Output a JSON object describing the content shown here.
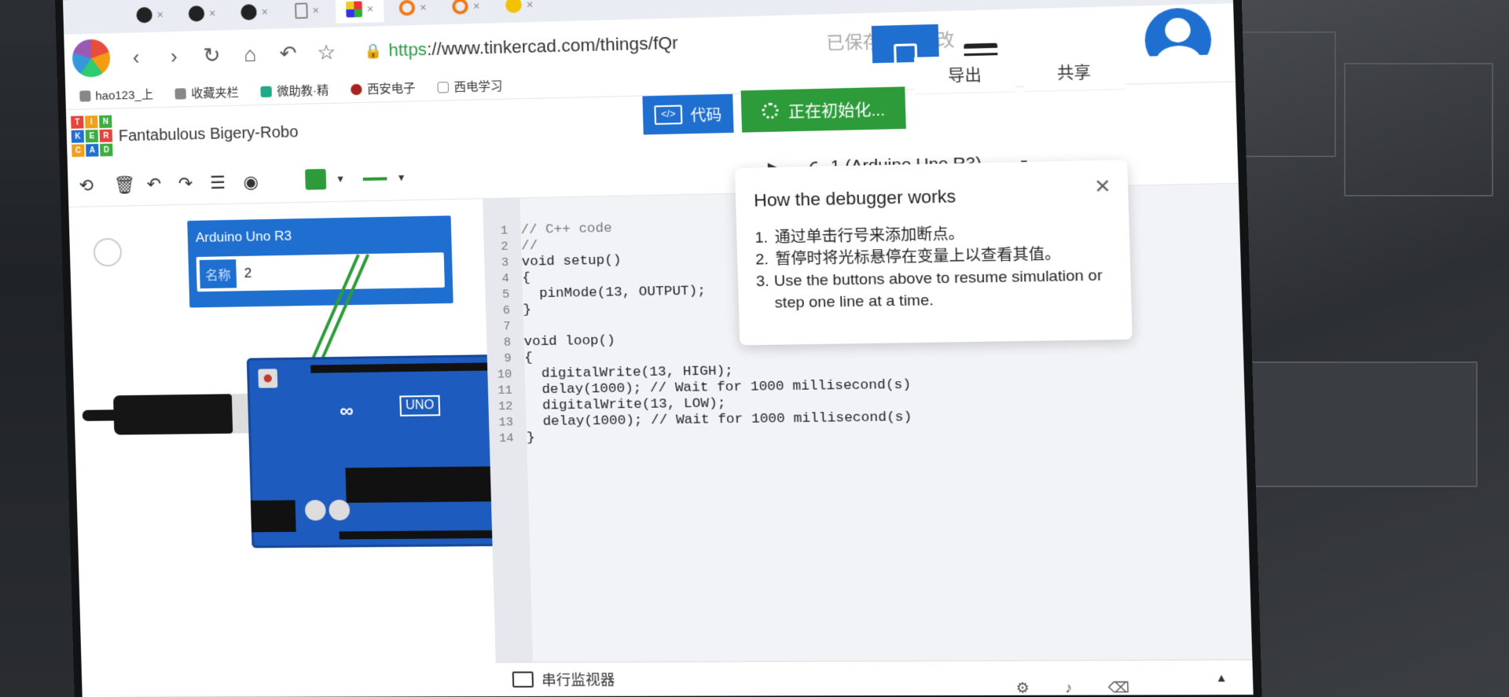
{
  "browser": {
    "url_scheme": "https",
    "url_rest": "://www.tinkercad.com/things/fQr",
    "saved_status": "已保存所有更改",
    "bookmarks": [
      "hao123_上",
      "收藏夹栏",
      "微助教·精",
      "西安电子",
      "西电学习"
    ]
  },
  "app": {
    "logo_letters": [
      "T",
      "I",
      "N",
      "K",
      "E",
      "R",
      "C",
      "A",
      "D"
    ],
    "project_title": "Fantabulous Bigery-Robo",
    "code_button": "代码",
    "code_icon_text": "</>",
    "init_button": "正在初始化...",
    "export_button": "导出",
    "share_button": "共享",
    "board_select": "1 (Arduino Uno R3)"
  },
  "properties": {
    "title": "Arduino Uno R3",
    "name_label": "名称",
    "name_value": "2"
  },
  "board": {
    "logo_text": "∞",
    "model": "UNO"
  },
  "code": {
    "lines": [
      {
        "n": "1",
        "text": "// C++ code",
        "comment": true
      },
      {
        "n": "2",
        "text": "//",
        "comment": true
      },
      {
        "n": "3",
        "text": "void setup()",
        "comment": false
      },
      {
        "n": "4",
        "text": "{",
        "comment": false
      },
      {
        "n": "5",
        "text": "  pinMode(13, OUTPUT);",
        "comment": false
      },
      {
        "n": "6",
        "text": "}",
        "comment": false
      },
      {
        "n": "7",
        "text": "",
        "comment": false
      },
      {
        "n": "8",
        "text": "void loop()",
        "comment": false
      },
      {
        "n": "9",
        "text": "{",
        "comment": false
      },
      {
        "n": "10",
        "text": "  digitalWrite(13, HIGH);",
        "comment": false
      },
      {
        "n": "11",
        "text": "  delay(1000); // Wait for 1000 millisecond(s)",
        "comment": false
      },
      {
        "n": "12",
        "text": "  digitalWrite(13, LOW);",
        "comment": false
      },
      {
        "n": "13",
        "text": "  delay(1000); // Wait for 1000 millisecond(s)",
        "comment": false
      },
      {
        "n": "14",
        "text": "}",
        "comment": false
      }
    ]
  },
  "debugger_popup": {
    "title": "How the debugger works",
    "close": "✕",
    "items": [
      {
        "num": "1.",
        "text": "通过单击行号来添加断点。"
      },
      {
        "num": "2.",
        "text": "暂停时将光标悬停在变量上以查看其值。"
      },
      {
        "num": "3.",
        "text": "Use the buttons above to resume simulation or step one line at a time."
      }
    ]
  },
  "serial_monitor": {
    "label": "串行监视器",
    "toggle": "▲"
  },
  "colors": {
    "accent_blue": "#1f6fd1",
    "init_green": "#2d9b3a",
    "wire_green": "#2d9b3a"
  },
  "icons": {
    "nav": [
      "back-icon",
      "forward-icon",
      "reload-icon",
      "home-icon",
      "undo-icon",
      "star-icon"
    ],
    "toolbar": [
      "rotate-icon",
      "delete-icon",
      "undo-icon",
      "redo-icon",
      "notes-icon",
      "visibility-icon"
    ]
  }
}
